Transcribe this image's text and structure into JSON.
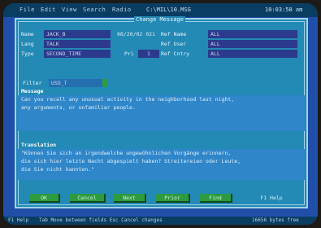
{
  "menu": {
    "items": [
      "File",
      "Edit",
      "View",
      "Search",
      "Radio"
    ],
    "filename": "C:\\MIL\\10.MSG",
    "clock": "10:03:58 am"
  },
  "dialog": {
    "title": "Change Message",
    "fields": {
      "name_label": "Name",
      "name_value": "JACK_B",
      "date_value": "08/20/02 021",
      "ref_name_label": "Ref Name",
      "ref_name_value": "ALL",
      "lang_label": "Lang",
      "lang_value": "TALK",
      "ref_user_label": "Ref User",
      "ref_user_value": "ALL",
      "type_label": "Type",
      "type_value": "SECOND_TIME",
      "pri_label": "Pri",
      "pri_value": "1",
      "ref_country_label": "Ref Cntry",
      "ref_country_value": "ALL",
      "filter_label": "Filter",
      "filter_value": "USD_T"
    },
    "message": {
      "label": "Message",
      "lines": [
        "Can you recall any unusual activity in the neighborhood last night,",
        "any arguments, or unfamiliar people."
      ]
    },
    "translation": {
      "label": "Translation",
      "lines": [
        "\"Können Sie sich an irgendwelche ungewöhnlichen Vorgänge erinnern,",
        "die sich hier letzte Nacht abgespielt haben? Streitereien oder Leute,",
        "die Sie nicht kannten.\""
      ]
    },
    "buttons": [
      "OK",
      "Cancel",
      "Next",
      "Prior",
      "Find"
    ],
    "help_button": "F1 Help"
  },
  "status": {
    "help": "F1 Help",
    "hint": "Tab Move between fields  Esc Cancel  changes",
    "bytes": "16656 bytes free"
  }
}
